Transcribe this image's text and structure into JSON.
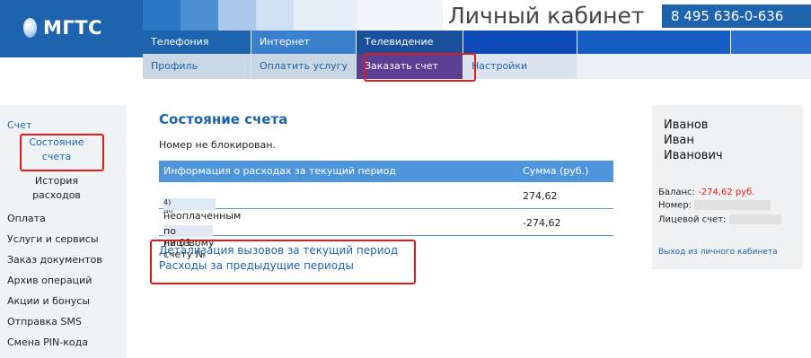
{
  "brand": {
    "logo_text": "МГТС",
    "title": "Личный кабинет",
    "phone": "8 495 636-0-636"
  },
  "nav_primary": [
    "Телефония",
    "Интернет",
    "Телевидение"
  ],
  "nav_secondary": [
    "Профиль",
    "Оплатить услугу",
    "Заказать счет",
    "Настройки"
  ],
  "sidebar": {
    "section": "Счет",
    "sub_items": [
      "Состояние счета",
      "История расходов"
    ],
    "items": [
      "Оплата",
      "Услуги и сервисы",
      "Заказ документов",
      "Архив операций",
      "Акции и бонусы",
      "Отправка SMS",
      "Смена PIN-кода"
    ]
  },
  "main": {
    "title": "Состояние счета",
    "status": "Номер не блокирован.",
    "table": {
      "headers": [
        "Информация о расходах за текущий период",
        "Сумма (руб.)"
      ],
      "rows": [
        {
          "label": "Сумма по неоплаченным счетам:",
          "note_start": "(оплатить до",
          "note_end": "4)",
          "value": "274,62"
        },
        {
          "label_start": "Остаток на 01",
          "label_end": "по лицевому счету №",
          "value": "-274,62"
        }
      ]
    },
    "links": [
      "Детализация вызовов за текущий период",
      "Расходы за предыдущие периоды"
    ]
  },
  "user": {
    "name_lines": [
      "Иванов",
      "Иван",
      "Иванович"
    ],
    "balance_label": "Баланс:",
    "balance_value": "-274,62 руб.",
    "number_label": "Номер:",
    "account_label": "Лицевой счет:",
    "logout": "Выход из личного кабинета"
  },
  "colors": {
    "brand": "#1e63ad",
    "active_tab": "#5b3f93",
    "highlight": "#e01b1b",
    "negative": "#e01b1b"
  }
}
